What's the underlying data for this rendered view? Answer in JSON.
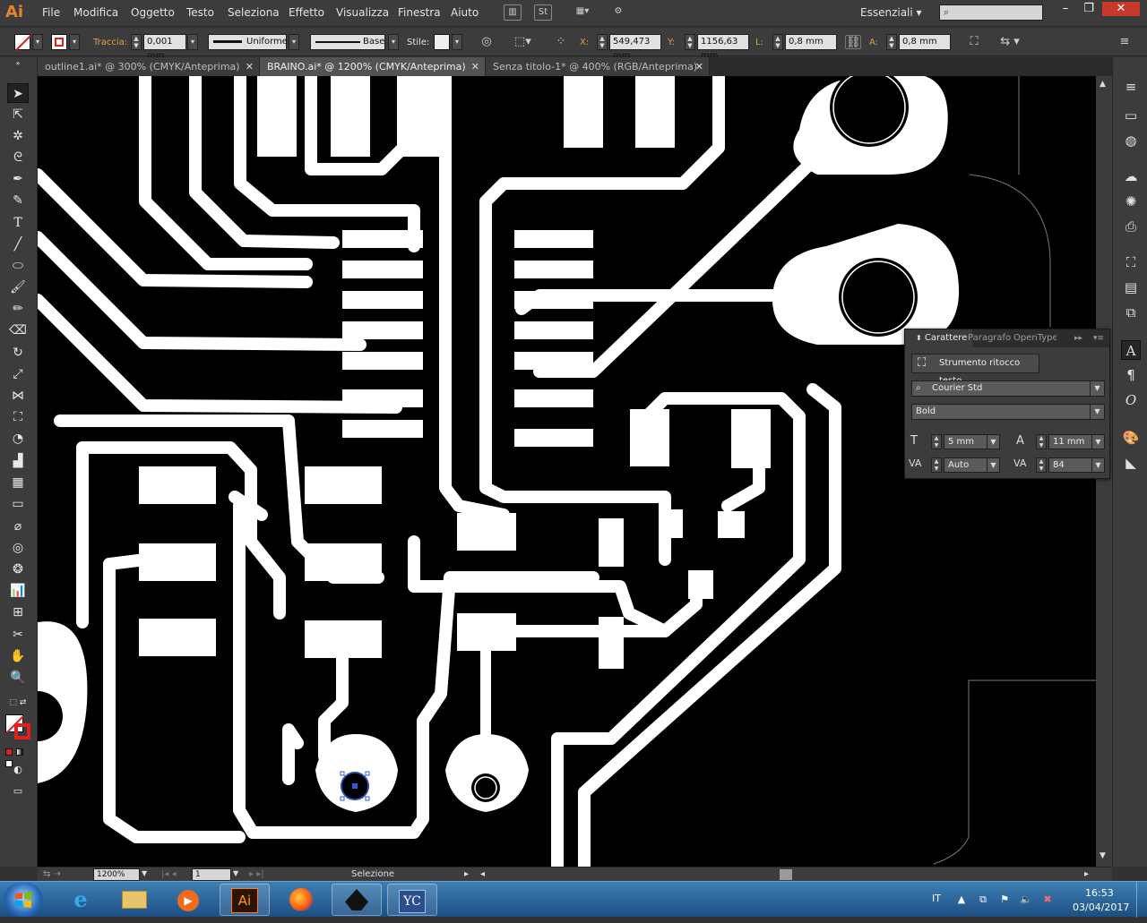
{
  "app": {
    "logo": "Ai",
    "workspace": "Essenziali"
  },
  "menu": [
    "File",
    "Modifica",
    "Oggetto",
    "Testo",
    "Seleziona",
    "Effetto",
    "Visualizza",
    "Finestra",
    "Aiuto"
  ],
  "menubar_icons": {
    "bridge": "Br-icon",
    "stock": "St",
    "arrange": "arrange-docs-icon",
    "gpu": "gpu-performance-icon"
  },
  "search": {
    "placeholder": ""
  },
  "control": {
    "stroke_label": "Traccia:",
    "stroke_weight": "0,001 mm",
    "profile": "Uniforme",
    "brush": "Base",
    "style_label": "Stile:",
    "x_label": "X:",
    "x_value": "549,473 mm",
    "y_label": "Y:",
    "y_value": "1156,63 mm",
    "w_label": "L:",
    "w_value": "0,8 mm",
    "h_label": "A:",
    "h_value": "0,8 mm"
  },
  "tabs": [
    {
      "label": "outline1.ai* @ 300% (CMYK/Anteprima)",
      "active": false
    },
    {
      "label": "BRAINO.ai* @ 1200% (CMYK/Anteprima)",
      "active": true
    },
    {
      "label": "Senza titolo-1* @ 400% (RGB/Anteprima)",
      "active": false
    }
  ],
  "character_panel": {
    "tabs": [
      "Carattere",
      "Paragrafo",
      "OpenType"
    ],
    "touch_tool": "Strumento ritocco testo",
    "font_family": "Courier Std",
    "font_style": "Bold",
    "font_size": "5 mm",
    "leading": "11 mm",
    "kerning": "Auto",
    "tracking": "84"
  },
  "status": {
    "zoom": "1200%",
    "artboard": "1",
    "tool": "Selezione"
  },
  "taskbar": {
    "apps": [
      "internet-explorer",
      "file-explorer",
      "media-player",
      "illustrator",
      "firefox",
      "inkscape",
      "yc-app"
    ],
    "language": "IT",
    "time": "16:53",
    "date": "03/04/2017"
  },
  "colors": {
    "accent": "#e8832a",
    "canvas": "#000000",
    "traces": "#ffffff",
    "selection": "#2b5bd7"
  }
}
